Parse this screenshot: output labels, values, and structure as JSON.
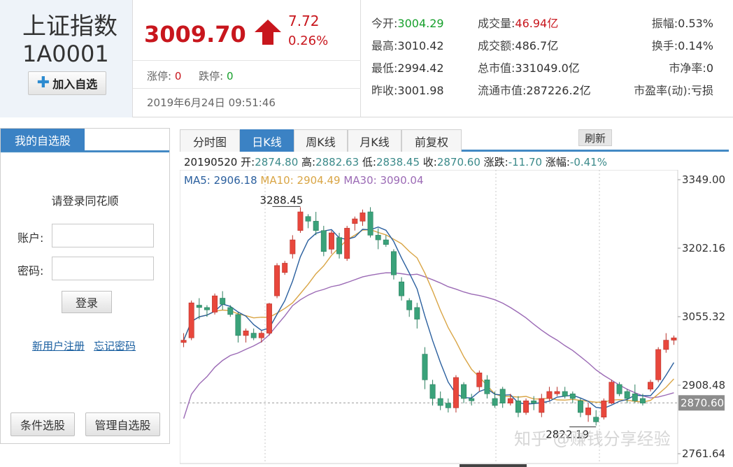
{
  "stock": {
    "name": "上证指数",
    "code": "1A0001",
    "add_fav_label": "加入自选"
  },
  "quote": {
    "price": "3009.70",
    "change": "7.72",
    "change_pct": "0.26%",
    "limit_up_label": "涨停:",
    "limit_up": "0",
    "limit_down_label": "跌停:",
    "limit_down": "0",
    "timestamp": "2019年6月24日 09:51:46",
    "up_color": "#c8161d",
    "down_color": "#17a02c"
  },
  "stats": [
    {
      "label": "今开:",
      "value": "3004.29",
      "color": "green"
    },
    {
      "label": "成交量:",
      "value": "46.94亿",
      "color": "red"
    },
    {
      "label": "振幅:",
      "value": "0.53%",
      "color": "normal"
    },
    {
      "label": "最高:",
      "value": "3010.42",
      "color": "normal"
    },
    {
      "label": "成交额:",
      "value": "486.7亿",
      "color": "normal"
    },
    {
      "label": "换手:",
      "value": "0.14%",
      "color": "normal"
    },
    {
      "label": "最低:",
      "value": "2994.42",
      "color": "normal"
    },
    {
      "label": "总市值:",
      "value": "331049.0亿",
      "color": "normal"
    },
    {
      "label": "市净率:",
      "value": "0",
      "color": "normal"
    },
    {
      "label": "昨收:",
      "value": "3001.98",
      "color": "normal"
    },
    {
      "label": "流通市值:",
      "value": "287226.2亿",
      "color": "normal"
    },
    {
      "label": "市盈率(动):",
      "value": "亏损",
      "color": "normal"
    }
  ],
  "sidebar": {
    "tab_label": "我的自选股",
    "login_prompt": "请登录同花顺",
    "account_label": "账户:",
    "password_label": "密码:",
    "login_button": "登录",
    "register_link": "新用户注册",
    "forgot_link": "忘记密码",
    "condition_button": "条件选股",
    "manage_button": "管理自选股",
    "accent": "#3b82c4"
  },
  "chart_tabs": [
    {
      "label": "分时图",
      "active": false
    },
    {
      "label": "日K线",
      "active": true
    },
    {
      "label": "周K线",
      "active": false
    },
    {
      "label": "月K线",
      "active": false
    },
    {
      "label": "前复权",
      "active": false
    }
  ],
  "refresh_label": "刷新",
  "ohlc": {
    "date": "20190520",
    "open_label": "开:",
    "open": "2874.80",
    "high_label": "高:",
    "high": "2882.63",
    "low_label": "低:",
    "low": "2838.45",
    "close_label": "收:",
    "close": "2870.60",
    "change_label": "涨跌:",
    "change": "-11.70",
    "pct_label": "涨幅:",
    "pct": "-0.41%"
  },
  "ma": {
    "ma5_label": "MA5:",
    "ma5": "2906.18",
    "ma5_color": "#2a5f9e",
    "ma10_label": "MA10:",
    "ma10": "2904.49",
    "ma10_color": "#d9a545",
    "ma30_label": "MA30:",
    "ma30": "3090.04",
    "ma30_color": "#9b6ab5"
  },
  "watermark": "知乎 @赚钱分享经验",
  "chart_data": {
    "type": "candlestick",
    "ylim": [
      2761.64,
      3349.0
    ],
    "y_ticks": [
      "3349.00",
      "3202.16",
      "3055.32",
      "2908.48",
      "2761.64"
    ],
    "current_price_label": "2870.60",
    "max_label": "3288.45",
    "min_label": "2822.19",
    "candle_up_color": "#e8473c",
    "candle_down_color": "#3aa27a",
    "candles": [
      [
        3000,
        3020,
        2990,
        3005
      ],
      [
        3010,
        3090,
        3005,
        3085
      ],
      [
        3080,
        3095,
        3050,
        3075
      ],
      [
        3075,
        3080,
        3055,
        3070
      ],
      [
        3065,
        3105,
        3060,
        3100
      ],
      [
        3095,
        3110,
        3070,
        3082
      ],
      [
        3075,
        3080,
        3055,
        3060
      ],
      [
        3060,
        3065,
        3000,
        3015
      ],
      [
        3015,
        3030,
        3000,
        3025
      ],
      [
        3020,
        3030,
        3005,
        3010
      ],
      [
        3010,
        3025,
        3000,
        3020
      ],
      [
        3020,
        3085,
        3015,
        3083
      ],
      [
        3100,
        3170,
        3095,
        3165
      ],
      [
        3150,
        3175,
        3145,
        3170
      ],
      [
        3190,
        3230,
        3180,
        3220
      ],
      [
        3240,
        3290,
        3235,
        3280
      ],
      [
        3270,
        3275,
        3245,
        3260
      ],
      [
        3260,
        3280,
        3230,
        3240
      ],
      [
        3240,
        3250,
        3185,
        3195
      ],
      [
        3200,
        3240,
        3190,
        3235
      ],
      [
        3225,
        3235,
        3180,
        3190
      ],
      [
        3180,
        3250,
        3175,
        3245
      ],
      [
        3255,
        3270,
        3240,
        3265
      ],
      [
        3260,
        3285,
        3250,
        3278
      ],
      [
        3280,
        3290,
        3225,
        3230
      ],
      [
        3230,
        3245,
        3200,
        3220
      ],
      [
        3220,
        3230,
        3205,
        3210
      ],
      [
        3195,
        3200,
        3135,
        3145
      ],
      [
        3130,
        3140,
        3090,
        3100
      ],
      [
        3090,
        3095,
        3055,
        3070
      ],
      [
        3075,
        3085,
        3030,
        3050
      ],
      [
        2975,
        2990,
        2900,
        2920
      ],
      [
        2910,
        2920,
        2865,
        2880
      ],
      [
        2880,
        2895,
        2855,
        2865
      ],
      [
        2870,
        2880,
        2850,
        2860
      ],
      [
        2860,
        2930,
        2850,
        2925
      ],
      [
        2910,
        2915,
        2870,
        2880
      ],
      [
        2880,
        2890,
        2865,
        2875
      ],
      [
        2905,
        2940,
        2895,
        2935
      ],
      [
        2920,
        2930,
        2880,
        2890
      ],
      [
        2880,
        2895,
        2860,
        2865
      ],
      [
        2900,
        2905,
        2860,
        2870
      ],
      [
        2870,
        2890,
        2865,
        2880
      ],
      [
        2875,
        2885,
        2840,
        2850
      ],
      [
        2850,
        2880,
        2845,
        2875
      ],
      [
        2875,
        2885,
        2855,
        2870
      ],
      [
        2850,
        2890,
        2840,
        2880
      ],
      [
        2880,
        2905,
        2875,
        2895
      ],
      [
        2890,
        2905,
        2885,
        2895
      ],
      [
        2895,
        2905,
        2880,
        2885
      ],
      [
        2890,
        2895,
        2870,
        2880
      ],
      [
        2875,
        2880,
        2840,
        2850
      ],
      [
        2845,
        2870,
        2830,
        2860
      ],
      [
        2840,
        2855,
        2822,
        2830
      ],
      [
        2840,
        2880,
        2835,
        2875
      ],
      [
        2870,
        2920,
        2868,
        2915
      ],
      [
        2910,
        2915,
        2885,
        2890
      ],
      [
        2895,
        2900,
        2870,
        2880
      ],
      [
        2890,
        2910,
        2870,
        2875
      ],
      [
        2880,
        2890,
        2865,
        2870
      ],
      [
        2900,
        2920,
        2895,
        2915
      ],
      [
        2920,
        2990,
        2915,
        2985
      ],
      [
        2985,
        3020,
        2978,
        3005
      ],
      [
        3005,
        3015,
        2995,
        3010
      ]
    ]
  }
}
